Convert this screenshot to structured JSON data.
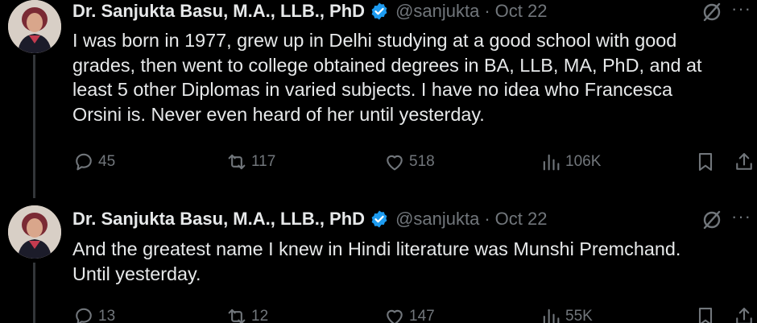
{
  "tweets": [
    {
      "author_name": "Dr. Sanjukta Basu, M.A., LLB., PhD",
      "handle": "@sanjukta",
      "separator": "·",
      "date": "Oct 22",
      "more": "···",
      "text": "I was born in 1977, grew up in Delhi studying at a good school with good\ngrades, then went to college obtained degrees in BA, LLB, MA, PhD, and at\nleast 5 other Diplomas in varied subjects. I have no idea who Francesca\nOrsini is. Never even heard of her until yesterday.",
      "replies": "45",
      "reposts": "117",
      "likes": "518",
      "views": "106K"
    },
    {
      "author_name": "Dr. Sanjukta Basu, M.A., LLB., PhD",
      "handle": "@sanjukta",
      "separator": "·",
      "date": "Oct 22",
      "more": "···",
      "text": "And the greatest name I knew in Hindi literature was Munshi Premchand.\nUntil yesterday.",
      "replies": "13",
      "reposts": "12",
      "likes": "147",
      "views": "55K"
    }
  ],
  "icons": {
    "reply": "reply-icon",
    "repost": "repost-icon",
    "like": "heart-icon",
    "views": "views-icon",
    "bookmark": "bookmark-icon",
    "share": "share-icon",
    "verified": "verified-badge-icon",
    "grok": "grok-icon"
  },
  "colors": {
    "background": "#000000",
    "text": "#e7e9ea",
    "secondary": "#71767b",
    "verified": "#1d9bf0"
  }
}
